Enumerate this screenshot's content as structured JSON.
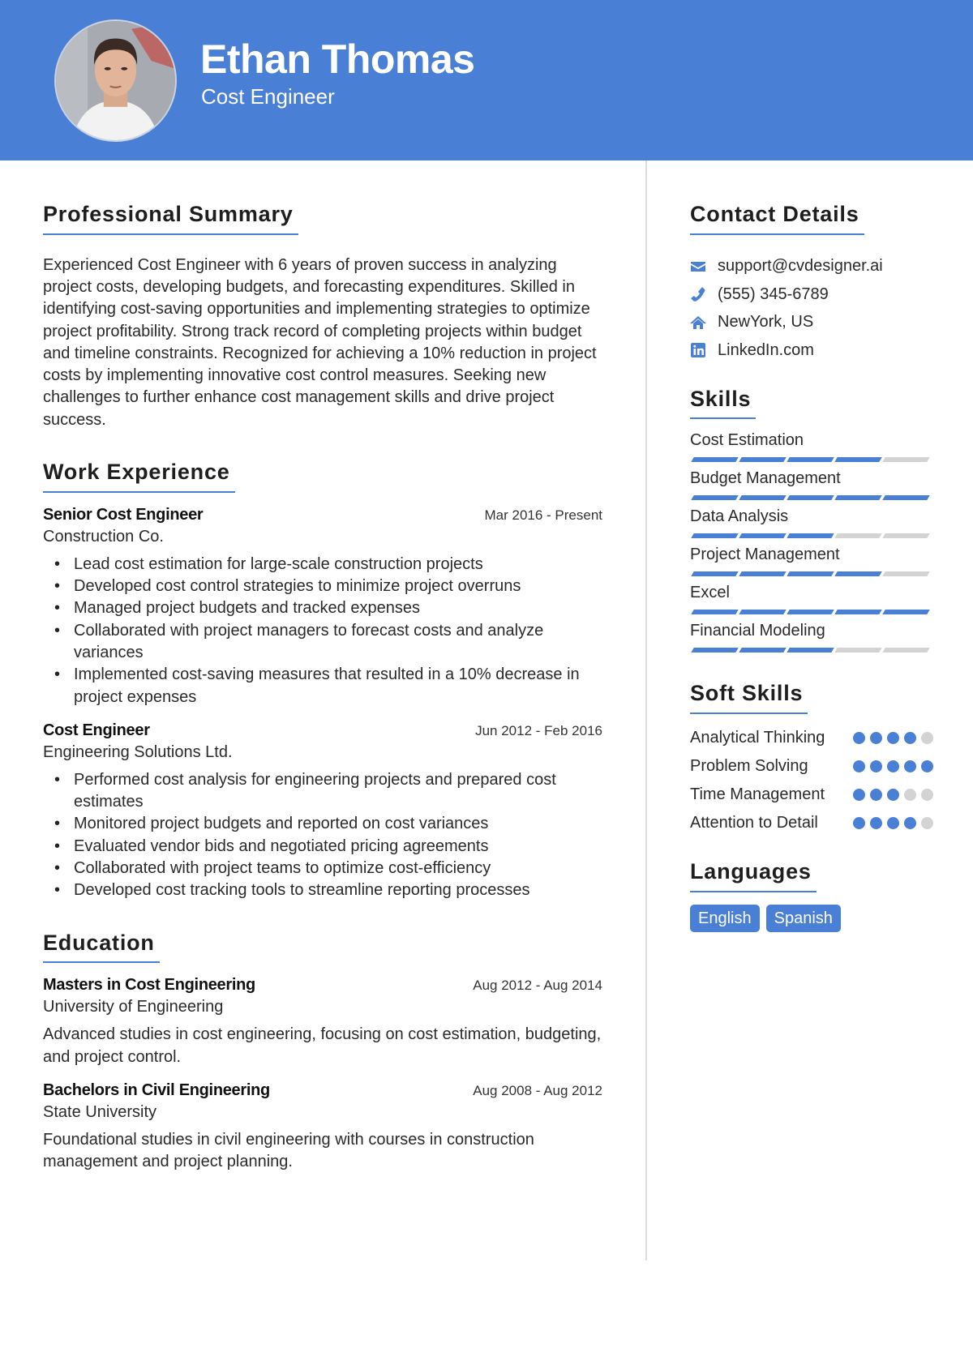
{
  "header": {
    "name": "Ethan Thomas",
    "title": "Cost Engineer",
    "photo_alt": "Profile photo"
  },
  "colors": {
    "accent": "#4A7FD6",
    "inactive": "#D3D3D3",
    "divider": "#DCDCDC"
  },
  "summary": {
    "heading": "Professional Summary",
    "text": "Experienced Cost Engineer with 6 years of proven success in analyzing project costs, developing budgets, and forecasting expenditures. Skilled in identifying cost-saving opportunities and implementing strategies to optimize project profitability. Strong track record of completing projects within budget and timeline constraints. Recognized for achieving a 10% reduction in project costs by implementing innovative cost control measures. Seeking new challenges to further enhance cost management skills and drive project success."
  },
  "experience": {
    "heading": "Work Experience",
    "jobs": [
      {
        "role": "Senior Cost Engineer",
        "dates": "Mar 2016 - Present",
        "company": "Construction Co.",
        "bullets": [
          "Lead cost estimation for large-scale construction projects",
          "Developed cost control strategies to minimize project overruns",
          "Managed project budgets and tracked expenses",
          "Collaborated with project managers to forecast costs and analyze variances",
          "Implemented cost-saving measures that resulted in a 10% decrease in project expenses"
        ]
      },
      {
        "role": "Cost Engineer",
        "dates": "Jun 2012 - Feb 2016",
        "company": "Engineering Solutions Ltd.",
        "bullets": [
          "Performed cost analysis for engineering projects and prepared cost estimates",
          "Monitored project budgets and reported on cost variances",
          "Evaluated vendor bids and negotiated pricing agreements",
          "Collaborated with project teams to optimize cost-efficiency",
          "Developed cost tracking tools to streamline reporting processes"
        ]
      }
    ]
  },
  "education": {
    "heading": "Education",
    "items": [
      {
        "degree": "Masters in Cost Engineering",
        "dates": "Aug 2012 - Aug 2014",
        "school": "University of Engineering",
        "description": "Advanced studies in cost engineering, focusing on cost estimation, budgeting, and project control."
      },
      {
        "degree": "Bachelors in Civil Engineering",
        "dates": "Aug 2008 - Aug 2012",
        "school": "State University",
        "description": "Foundational studies in civil engineering with courses in construction management and project planning."
      }
    ]
  },
  "contact": {
    "heading": "Contact Details",
    "items": [
      {
        "icon": "envelope-icon",
        "text": "support@cvdesigner.ai"
      },
      {
        "icon": "phone-icon",
        "text": "(555) 345-6789"
      },
      {
        "icon": "home-icon",
        "text": "NewYork, US"
      },
      {
        "icon": "linkedin-icon",
        "text": "LinkedIn.com"
      }
    ]
  },
  "skills": {
    "heading": "Skills",
    "max": 5,
    "items": [
      {
        "name": "Cost Estimation",
        "level": 4
      },
      {
        "name": "Budget Management",
        "level": 5
      },
      {
        "name": "Data Analysis",
        "level": 3
      },
      {
        "name": "Project Management",
        "level": 4
      },
      {
        "name": "Excel",
        "level": 5
      },
      {
        "name": "Financial Modeling",
        "level": 3
      }
    ]
  },
  "soft_skills": {
    "heading": "Soft Skills",
    "max": 5,
    "items": [
      {
        "name": "Analytical Thinking",
        "level": 4
      },
      {
        "name": "Problem Solving",
        "level": 5
      },
      {
        "name": "Time Management",
        "level": 3
      },
      {
        "name": "Attention to Detail",
        "level": 4
      }
    ]
  },
  "languages": {
    "heading": "Languages",
    "items": [
      "English",
      "Spanish"
    ]
  }
}
